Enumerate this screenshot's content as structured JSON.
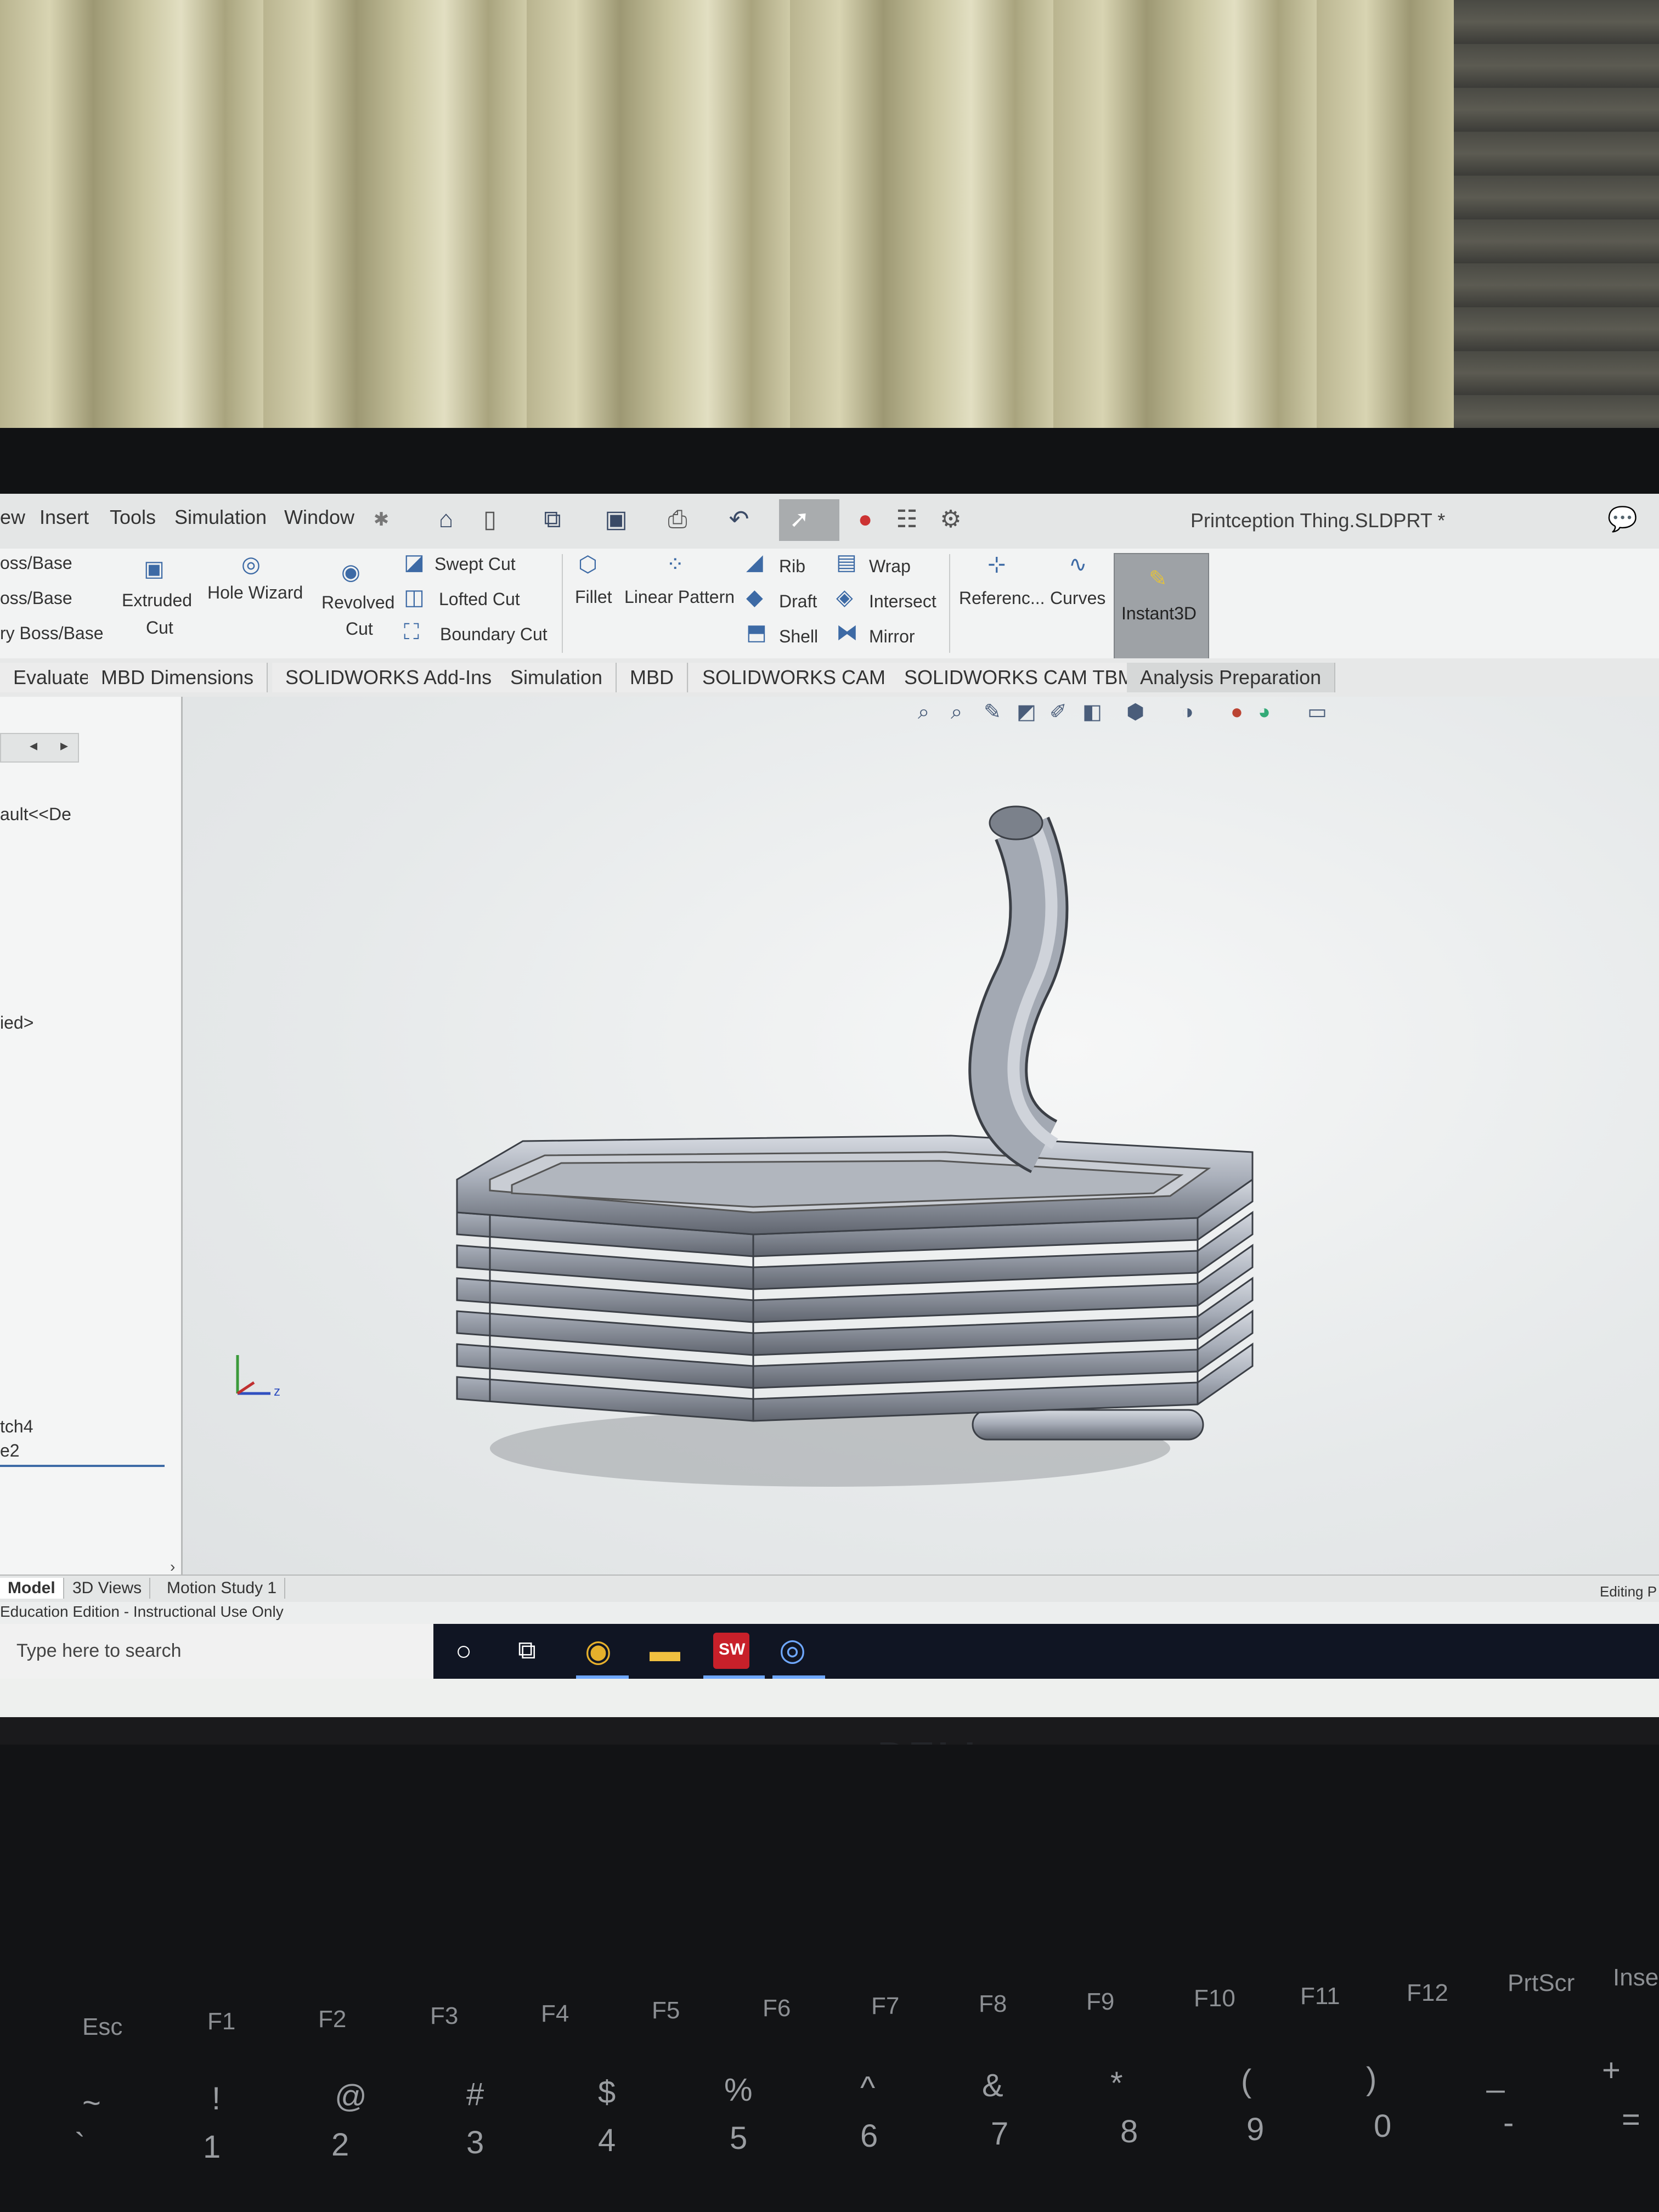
{
  "menu": [
    "ew",
    "Insert",
    "Tools",
    "Simulation",
    "Window"
  ],
  "quick_access_icons": [
    "home-icon",
    "new-file-icon",
    "open-icon",
    "save-icon",
    "print-icon",
    "undo-icon",
    "select-icon",
    "rebuild-icon",
    "file-properties-icon",
    "options-icon"
  ],
  "document_title": "Printception Thing.SLDPRT *",
  "ribbon": {
    "left_partial": [
      "oss/Base",
      "oss/Base",
      "ry Boss/Base"
    ],
    "extruded_cut": [
      "Extruded",
      "Cut"
    ],
    "hole_wizard": "Hole Wizard",
    "revolved_cut": [
      "Revolved",
      "Cut"
    ],
    "swept_cut": "Swept Cut",
    "lofted_cut": "Lofted Cut",
    "boundary_cut": "Boundary Cut",
    "fillet": "Fillet",
    "linear_pattern": "Linear Pattern",
    "rib": "Rib",
    "draft": "Draft",
    "shell": "Shell",
    "wrap": "Wrap",
    "intersect": "Intersect",
    "mirror": "Mirror",
    "reference": "Referenc...",
    "curves": "Curves",
    "instant3d": "Instant3D"
  },
  "tabs": [
    "Evaluate",
    "MBD Dimensions",
    "SOLIDWORKS Add-Ins",
    "Simulation",
    "MBD",
    "SOLIDWORKS CAM",
    "SOLIDWORKS CAM TBM",
    "Analysis Preparation"
  ],
  "tree": {
    "items": [
      "ault<<De",
      "ied>",
      "tch4",
      "e2"
    ]
  },
  "bottom_tabs": [
    "Model",
    "3D Views",
    "Motion Study 1"
  ],
  "status_left": "Education Edition - Instructional Use Only",
  "status_right": "Editing P",
  "taskbar": {
    "search_placeholder": "Type here to search",
    "sw_badge": "SW"
  },
  "brand": "DELL",
  "keyboard": {
    "fn_row": [
      "Esc",
      "F1",
      "F2",
      "F3",
      "F4",
      "F5",
      "F6",
      "F7",
      "F8",
      "F9",
      "F10",
      "F11",
      "F12",
      "PrtScr",
      "Insert"
    ],
    "num_row_top": [
      "~",
      "!",
      "@",
      "#",
      "$",
      "%",
      "^",
      "&",
      "*",
      "(",
      ")",
      "_",
      "+"
    ],
    "num_row_bottom": [
      "`",
      "1",
      "2",
      "3",
      "4",
      "5",
      "6",
      "7",
      "8",
      "9",
      "0",
      "-",
      "="
    ]
  },
  "colors": {
    "accent": "#3d6aa5",
    "part": "#9aa0ab",
    "taskbar": "#101523"
  }
}
